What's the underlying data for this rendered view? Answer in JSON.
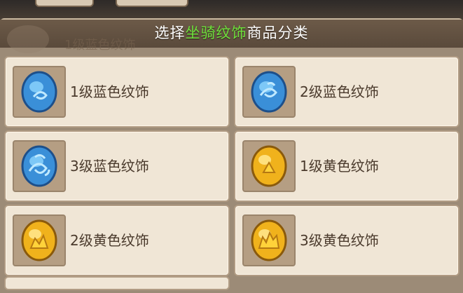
{
  "header": {
    "title_prefix": "选择",
    "title_highlight": "坐骑纹饰",
    "title_suffix": "商品分类",
    "ghost_label": "1级蓝色纹饰",
    "highlight_color": "#6ee03c"
  },
  "items": [
    {
      "label": "1级蓝色纹饰",
      "icon": "blue-ornament-icon",
      "gem": "blue"
    },
    {
      "label": "2级蓝色纹饰",
      "icon": "blue-ornament-icon",
      "gem": "blue"
    },
    {
      "label": "3级蓝色纹饰",
      "icon": "blue-ornament-icon",
      "gem": "blue"
    },
    {
      "label": "1级黄色纹饰",
      "icon": "yellow-ornament-icon",
      "gem": "yellow"
    },
    {
      "label": "2级黄色纹饰",
      "icon": "yellow-ornament-icon",
      "gem": "yellow"
    },
    {
      "label": "3级黄色纹饰",
      "icon": "yellow-ornament-icon",
      "gem": "yellow"
    }
  ]
}
